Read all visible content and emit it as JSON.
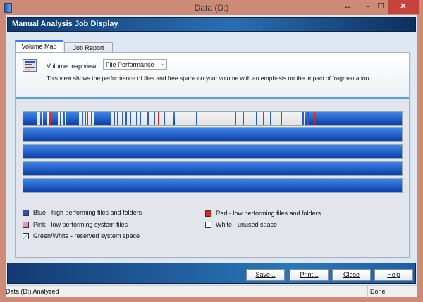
{
  "window": {
    "title": "Data (D:)",
    "close_label": "✕",
    "minimize_label": "–",
    "maximize_label": "☐",
    "resize_label": "↔"
  },
  "header": {
    "title": "Manual Analysis Job Display"
  },
  "tabs": [
    {
      "label": "Volume Map",
      "active": true
    },
    {
      "label": "Job Report",
      "active": false
    }
  ],
  "view": {
    "label": "Volume map view:",
    "selected": "File Performance",
    "description": "This view shows the performance of files and free space on your volume with an emphasis on the impact of fragmentation."
  },
  "legend": [
    {
      "label": "Blue - high performing files and folders",
      "color": "#2255cc"
    },
    {
      "label": "Red - low performing files and folders",
      "color": "#e0261b"
    },
    {
      "label": "Pink - low performing system files",
      "color": "#f08cb8"
    },
    {
      "label": "White - unused space",
      "color": "#ffffff"
    },
    {
      "label": "Green/White - reserved system space",
      "color": "#ffffff"
    }
  ],
  "buttons": {
    "save": "Save...",
    "print": "Print...",
    "close": "Close",
    "help": "Help"
  },
  "status": {
    "left": "Data (D:) Analyzed",
    "right": "Done"
  }
}
